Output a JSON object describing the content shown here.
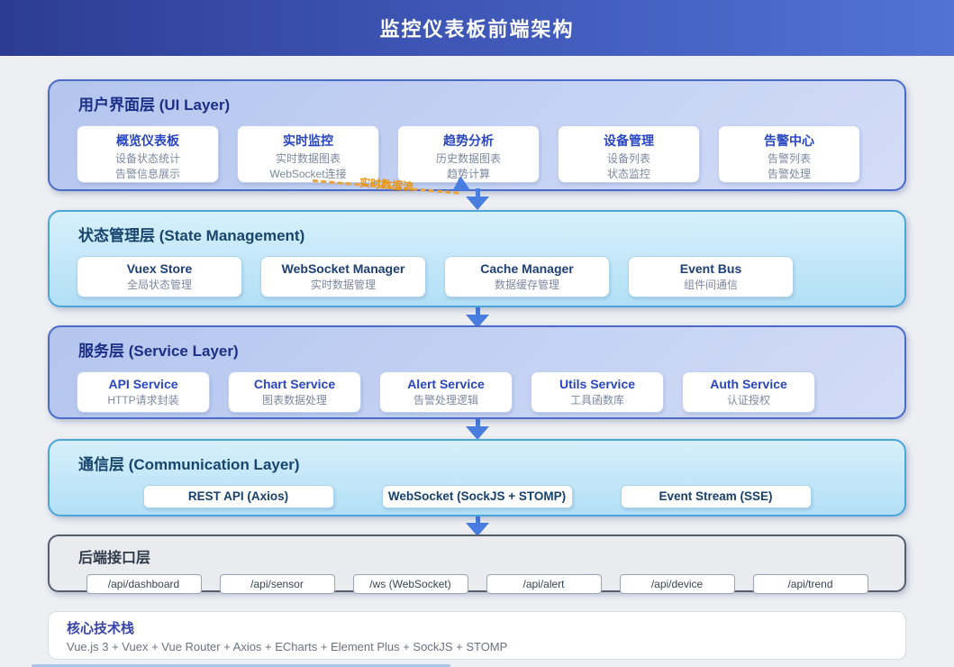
{
  "header": {
    "title": "监控仪表板前端架构"
  },
  "ui_layer": {
    "title": "用户界面层 (UI Layer)",
    "cards": [
      {
        "title": "概览仪表板",
        "lines": [
          "设备状态统计",
          "告警信息展示"
        ]
      },
      {
        "title": "实时监控",
        "lines": [
          "实时数据图表",
          "WebSocket连接"
        ]
      },
      {
        "title": "趋势分析",
        "lines": [
          "历史数据图表",
          "趋势计算"
        ]
      },
      {
        "title": "设备管理",
        "lines": [
          "设备列表",
          "状态监控"
        ]
      },
      {
        "title": "告警中心",
        "lines": [
          "告警列表",
          "告警处理"
        ]
      }
    ]
  },
  "flow": {
    "label": "实时数据流"
  },
  "state_layer": {
    "title": "状态管理层 (State Management)",
    "cards": [
      {
        "title": "Vuex Store",
        "lines": [
          "全局状态管理"
        ]
      },
      {
        "title": "WebSocket Manager",
        "lines": [
          "实时数据管理"
        ]
      },
      {
        "title": "Cache Manager",
        "lines": [
          "数据缓存管理"
        ]
      },
      {
        "title": "Event Bus",
        "lines": [
          "组件间通信"
        ]
      }
    ]
  },
  "service_layer": {
    "title": "服务层 (Service Layer)",
    "cards": [
      {
        "title": "API Service",
        "lines": [
          "HTTP请求封装"
        ]
      },
      {
        "title": "Chart Service",
        "lines": [
          "图表数据处理"
        ]
      },
      {
        "title": "Alert Service",
        "lines": [
          "告警处理逻辑"
        ]
      },
      {
        "title": "Utils Service",
        "lines": [
          "工具函数库"
        ]
      },
      {
        "title": "Auth Service",
        "lines": [
          "认证授权"
        ]
      }
    ]
  },
  "comm_layer": {
    "title": "通信层 (Communication Layer)",
    "cards": [
      "REST API (Axios)",
      "WebSocket (SockJS + STOMP)",
      "Event Stream (SSE)"
    ]
  },
  "backend_layer": {
    "title": "后端接口层",
    "endpoints": [
      "/api/dashboard",
      "/api/sensor",
      "/ws (WebSocket)",
      "/api/alert",
      "/api/device",
      "/api/trend"
    ]
  },
  "tech_stack": {
    "title": "核心技术栈",
    "stack": "Vue.js 3 + Vuex + Vue Router + Axios + ECharts + Element Plus + SockJS + STOMP"
  },
  "colors": {
    "banner_gradient_start": "#2d3c92",
    "banner_gradient_end": "#5273d2",
    "blue_layer_border": "#4a6cc8",
    "cyan_layer_border": "#4ba6da",
    "gray_layer_border": "#555f6e",
    "card_title_blue": "#2946c2",
    "arrow_blue": "#4a7de0",
    "flow_dash_orange": "#e8a43e"
  }
}
